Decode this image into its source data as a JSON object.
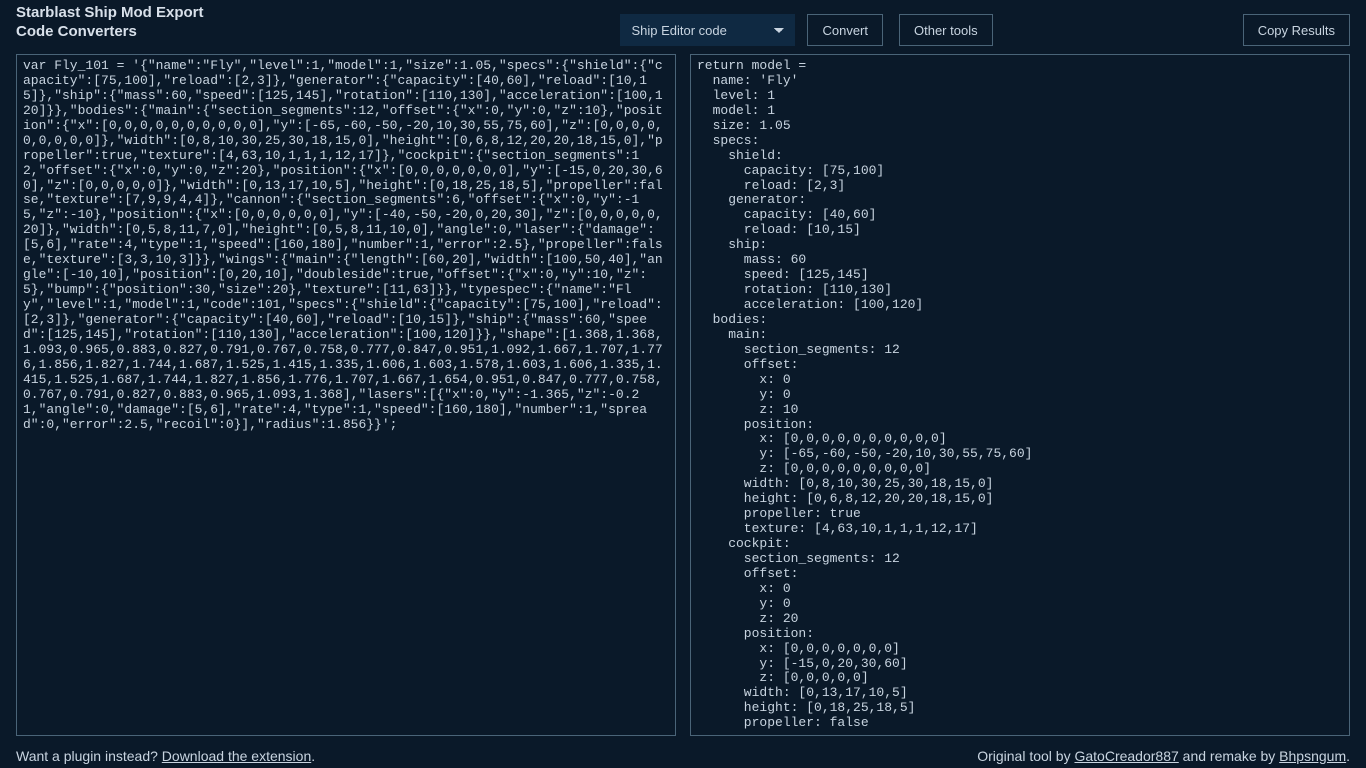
{
  "header": {
    "title_line1": "Starblast Ship Mod Export",
    "title_line2": "Code Converters",
    "dropdown_selected": "Ship Editor code",
    "convert_button": "Convert",
    "other_tools_button": "Other tools",
    "copy_results_button": "Copy Results"
  },
  "left_code": "var Fly_101 = '{\"name\":\"Fly\",\"level\":1,\"model\":1,\"size\":1.05,\"specs\":{\"shield\":{\"capacity\":[75,100],\"reload\":[2,3]},\"generator\":{\"capacity\":[40,60],\"reload\":[10,15]},\"ship\":{\"mass\":60,\"speed\":[125,145],\"rotation\":[110,130],\"acceleration\":[100,120]}},\"bodies\":{\"main\":{\"section_segments\":12,\"offset\":{\"x\":0,\"y\":0,\"z\":10},\"position\":{\"x\":[0,0,0,0,0,0,0,0,0,0],\"y\":[-65,-60,-50,-20,10,30,55,75,60],\"z\":[0,0,0,0,0,0,0,0,0]},\"width\":[0,8,10,30,25,30,18,15,0],\"height\":[0,6,8,12,20,20,18,15,0],\"propeller\":true,\"texture\":[4,63,10,1,1,1,12,17]},\"cockpit\":{\"section_segments\":12,\"offset\":{\"x\":0,\"y\":0,\"z\":20},\"position\":{\"x\":[0,0,0,0,0,0,0],\"y\":[-15,0,20,30,60],\"z\":[0,0,0,0,0]},\"width\":[0,13,17,10,5],\"height\":[0,18,25,18,5],\"propeller\":false,\"texture\":[7,9,9,4,4]},\"cannon\":{\"section_segments\":6,\"offset\":{\"x\":0,\"y\":-15,\"z\":-10},\"position\":{\"x\":[0,0,0,0,0,0],\"y\":[-40,-50,-20,0,20,30],\"z\":[0,0,0,0,0,20]},\"width\":[0,5,8,11,7,0],\"height\":[0,5,8,11,10,0],\"angle\":0,\"laser\":{\"damage\":[5,6],\"rate\":4,\"type\":1,\"speed\":[160,180],\"number\":1,\"error\":2.5},\"propeller\":false,\"texture\":[3,3,10,3]}},\"wings\":{\"main\":{\"length\":[60,20],\"width\":[100,50,40],\"angle\":[-10,10],\"position\":[0,20,10],\"doubleside\":true,\"offset\":{\"x\":0,\"y\":10,\"z\":5},\"bump\":{\"position\":30,\"size\":20},\"texture\":[11,63]}},\"typespec\":{\"name\":\"Fly\",\"level\":1,\"model\":1,\"code\":101,\"specs\":{\"shield\":{\"capacity\":[75,100],\"reload\":[2,3]},\"generator\":{\"capacity\":[40,60],\"reload\":[10,15]},\"ship\":{\"mass\":60,\"speed\":[125,145],\"rotation\":[110,130],\"acceleration\":[100,120]}},\"shape\":[1.368,1.368,1.093,0.965,0.883,0.827,0.791,0.767,0.758,0.777,0.847,0.951,1.092,1.667,1.707,1.776,1.856,1.827,1.744,1.687,1.525,1.415,1.335,1.606,1.603,1.578,1.603,1.606,1.335,1.415,1.525,1.687,1.744,1.827,1.856,1.776,1.707,1.667,1.654,0.951,0.847,0.777,0.758,0.767,0.791,0.827,0.883,0.965,1.093,1.368],\"lasers\":[{\"x\":0,\"y\":-1.365,\"z\":-0.21,\"angle\":0,\"damage\":[5,6],\"rate\":4,\"type\":1,\"speed\":[160,180],\"number\":1,\"spread\":0,\"error\":2.5,\"recoil\":0}],\"radius\":1.856}}';",
  "right_code": "return model =\n  name: 'Fly'\n  level: 1\n  model: 1\n  size: 1.05\n  specs:\n    shield:\n      capacity: [75,100]\n      reload: [2,3]\n    generator:\n      capacity: [40,60]\n      reload: [10,15]\n    ship:\n      mass: 60\n      speed: [125,145]\n      rotation: [110,130]\n      acceleration: [100,120]\n  bodies:\n    main:\n      section_segments: 12\n      offset:\n        x: 0\n        y: 0\n        z: 10\n      position:\n        x: [0,0,0,0,0,0,0,0,0,0]\n        y: [-65,-60,-50,-20,10,30,55,75,60]\n        z: [0,0,0,0,0,0,0,0,0]\n      width: [0,8,10,30,25,30,18,15,0]\n      height: [0,6,8,12,20,20,18,15,0]\n      propeller: true\n      texture: [4,63,10,1,1,1,12,17]\n    cockpit:\n      section_segments: 12\n      offset:\n        x: 0\n        y: 0\n        z: 20\n      position:\n        x: [0,0,0,0,0,0,0]\n        y: [-15,0,20,30,60]\n        z: [0,0,0,0,0]\n      width: [0,13,17,10,5]\n      height: [0,18,25,18,5]\n      propeller: false",
  "footer": {
    "plugin_text": "Want a plugin instead? ",
    "plugin_link": "Download the extension",
    "credits_prefix": "Original tool by ",
    "credits_author1": "GatoCreador887",
    "credits_mid": " and remake by ",
    "credits_author2": "Bhpsngum"
  }
}
